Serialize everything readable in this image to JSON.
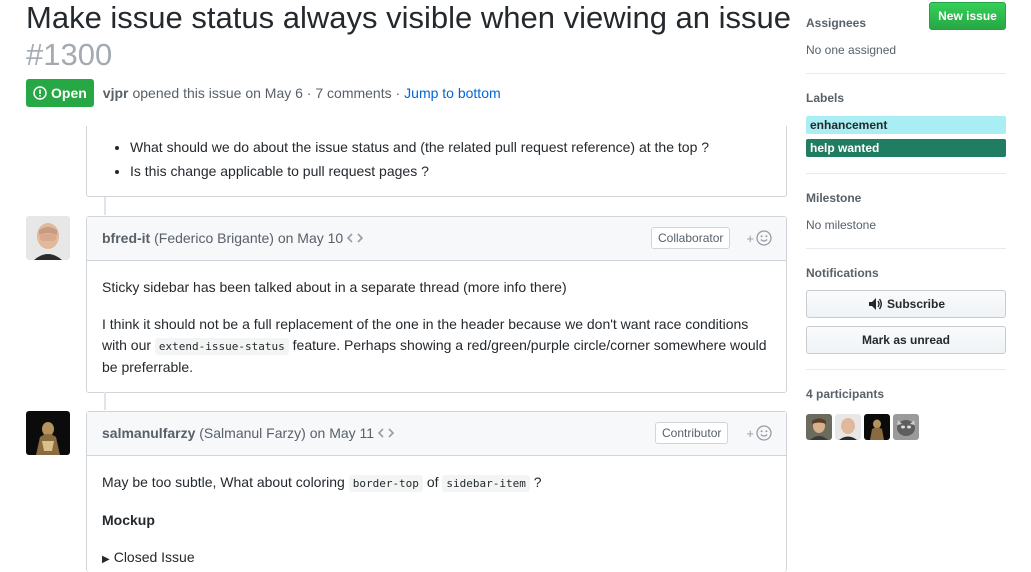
{
  "issue": {
    "title": "Make issue status always visible when viewing an issue",
    "number": "#1300",
    "state": "Open",
    "author": "vjpr",
    "opened_text": "opened this issue on May 6 · 7 comments ·",
    "jump_link": "Jump to bottom"
  },
  "previous_comment": {
    "bullets": [
      "What should we do about the issue status and (the related pull request reference) at the top ?",
      "Is this change applicable to pull request pages ?"
    ]
  },
  "comments": [
    {
      "username": "bfred-it",
      "fullname": "(Federico Brigante) on May 10",
      "badge": "Collaborator",
      "p1": "Sticky sidebar has been talked about in a separate thread (more info there)",
      "p2_pre": "I think it should not be a full replacement of the one in the header because we don't want race conditions",
      "p2_with": "with our",
      "p2_code": "extend-issue-status",
      "p2_post": "feature. Perhaps showing a red/green/purple circle/corner somewhere would",
      "p2_end": "be preferrable."
    },
    {
      "username": "salmanulfarzy",
      "fullname": "(Salmanul Farzy) on May 11",
      "badge": "Contributor",
      "p1_pre": "May be too subtle, What about coloring",
      "p1_code1": "border-top",
      "p1_of": "of",
      "p1_code2": "sidebar-item",
      "p1_q": "?",
      "mockup_heading": "Mockup",
      "details_summary": "Closed Issue"
    }
  ],
  "sidebar": {
    "new_issue": "New issue",
    "assignees_heading": "Assignees",
    "assignees_value": "No one assigned",
    "labels_heading": "Labels",
    "labels": [
      {
        "name": "enhancement",
        "bg": "#a9eef2",
        "fg": "#24292e"
      },
      {
        "name": "help wanted",
        "bg": "#217d62",
        "fg": "#ffffff"
      }
    ],
    "milestone_heading": "Milestone",
    "milestone_value": "No milestone",
    "notifications_heading": "Notifications",
    "subscribe": "Subscribe",
    "mark_unread": "Mark as unread",
    "participants_heading": "4 participants"
  },
  "colors": {
    "open_green": "#28a745",
    "link_blue": "#0366d6"
  },
  "icons": [
    "issue-opened-icon",
    "code-icon",
    "smiley-icon",
    "speaker-icon"
  ]
}
